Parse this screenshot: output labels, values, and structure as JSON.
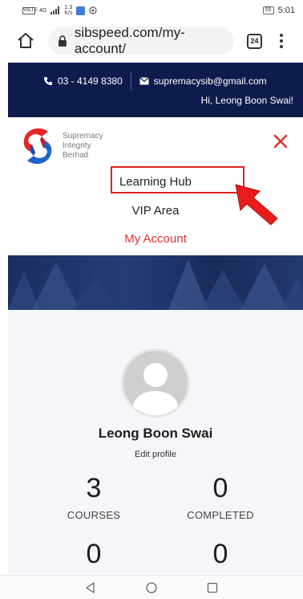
{
  "status_bar": {
    "sim_label": "VoLTE",
    "network": "4G",
    "speed_top": "1.3",
    "speed_bottom": "K/s",
    "battery": "55",
    "time": "5:01"
  },
  "browser": {
    "url": "sibspeed.com/my-account/",
    "tab_count": "24"
  },
  "top_bar": {
    "phone": "03 - 4149 8380",
    "email": "supremacysib@gmail.com",
    "greeting": "Hi, Leong Boon Swai!"
  },
  "logo": {
    "line1": "Supremacy",
    "line2": "Integrity",
    "line3": "Berhad"
  },
  "menu": {
    "items": [
      {
        "label": "Learning Hub"
      },
      {
        "label": "VIP Area"
      },
      {
        "label": "My Account"
      }
    ]
  },
  "profile": {
    "name": "Leong Boon Swai",
    "edit_label": "Edit profile",
    "stats": [
      {
        "value": "3",
        "label": "COURSES"
      },
      {
        "value": "0",
        "label": "COMPLETED"
      },
      {
        "value": "0",
        "label": ""
      },
      {
        "value": "0",
        "label": ""
      }
    ]
  },
  "colors": {
    "top_bar_bg": "#0e1b4d",
    "accent_red": "#e03232",
    "profile_bg": "#f4f6f9"
  }
}
